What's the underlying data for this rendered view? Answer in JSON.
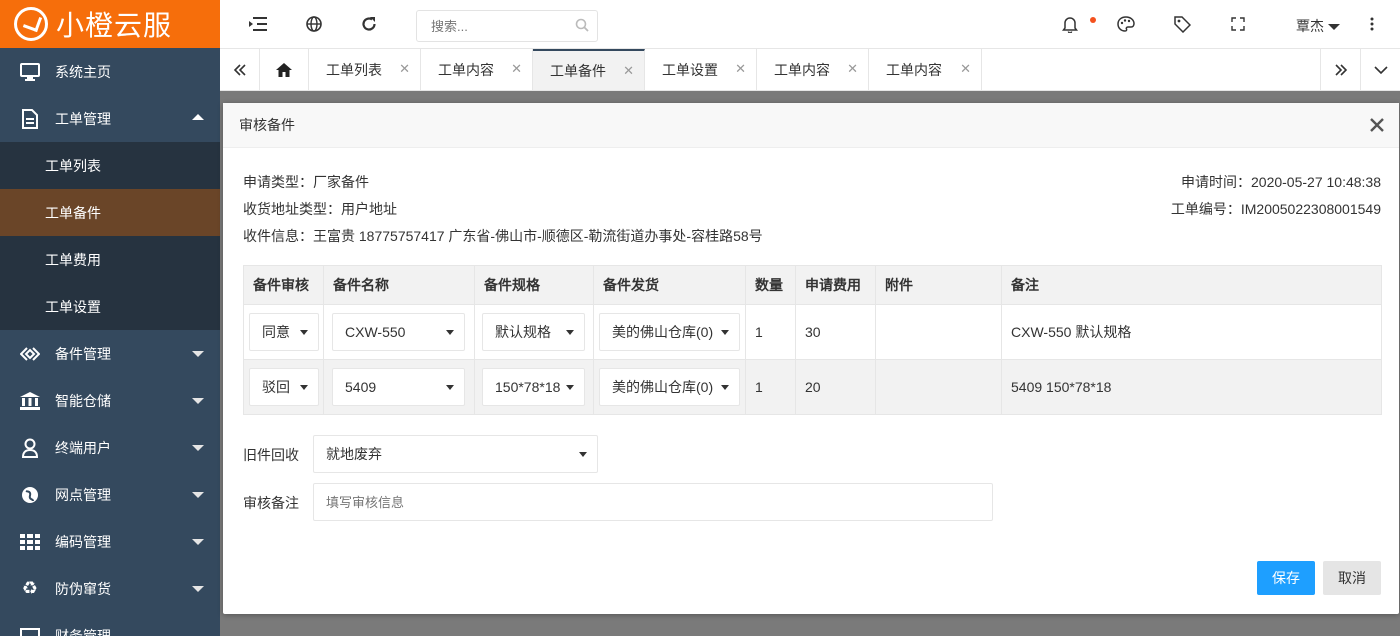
{
  "app": {
    "logo_text": "小橙云服",
    "brand_color": "#f66e0b",
    "sidebar_color": "#34495e"
  },
  "sidebar": {
    "items": [
      {
        "label": "系统主页",
        "icon": "monitor-icon"
      },
      {
        "label": "工单管理",
        "icon": "document-icon",
        "expanded": true
      },
      {
        "label": "备件管理",
        "icon": "parts-icon"
      },
      {
        "label": "智能仓储",
        "icon": "bank-icon"
      },
      {
        "label": "终端用户",
        "icon": "user-icon"
      },
      {
        "label": "网点管理",
        "icon": "globe-icon"
      },
      {
        "label": "编码管理",
        "icon": "grid-icon"
      },
      {
        "label": "防伪窜货",
        "icon": "recycle-icon"
      },
      {
        "label": "财务管理",
        "icon": "finance-icon"
      }
    ],
    "subitems": [
      {
        "label": "工单列表"
      },
      {
        "label": "工单备件",
        "active": true
      },
      {
        "label": "工单费用"
      },
      {
        "label": "工单设置"
      }
    ]
  },
  "topbar": {
    "search_placeholder": "搜索...",
    "user_name": "覃杰"
  },
  "tabs": [
    {
      "label": "工单列表"
    },
    {
      "label": "工单内容"
    },
    {
      "label": "工单备件",
      "active": true
    },
    {
      "label": "工单设置"
    },
    {
      "label": "工单内容"
    },
    {
      "label": "工单内容"
    }
  ],
  "modal": {
    "title": "审核备件",
    "apply_type_label": "申请类型：",
    "apply_type": "厂家备件",
    "address_type_label": "收货地址类型：",
    "address_type": "用户地址",
    "receiver_label": "收件信息：",
    "receiver": "王富贵 18775757417 广东省-佛山市-顺德区-勒流街道办事处-容桂路58号",
    "apply_time_label": "申请时间：",
    "apply_time": "2020-05-27 10:48:38",
    "order_no_label": "工单编号：",
    "order_no": "IM2005022308001549",
    "table": {
      "headers": [
        "备件审核",
        "备件名称",
        "备件规格",
        "备件发货",
        "数量",
        "申请费用",
        "附件",
        "备注"
      ],
      "rows": [
        {
          "audit": "同意",
          "name": "CXW-550",
          "spec": "默认规格",
          "warehouse": "美的佛山仓库(0)",
          "qty": "1",
          "fee": "30",
          "attachment": "",
          "remark": "CXW-550 默认规格"
        },
        {
          "audit": "驳回",
          "name": "5409",
          "spec": "150*78*18",
          "warehouse": "美的佛山仓库(0)",
          "qty": "1",
          "fee": "20",
          "attachment": "",
          "remark": "5409 150*78*18"
        }
      ]
    },
    "recycle_label": "旧件回收",
    "recycle_value": "就地废弃",
    "audit_remark_label": "审核备注",
    "audit_remark_placeholder": "填写审核信息",
    "save_label": "保存",
    "cancel_label": "取消",
    "save_color": "#1e9fff"
  }
}
